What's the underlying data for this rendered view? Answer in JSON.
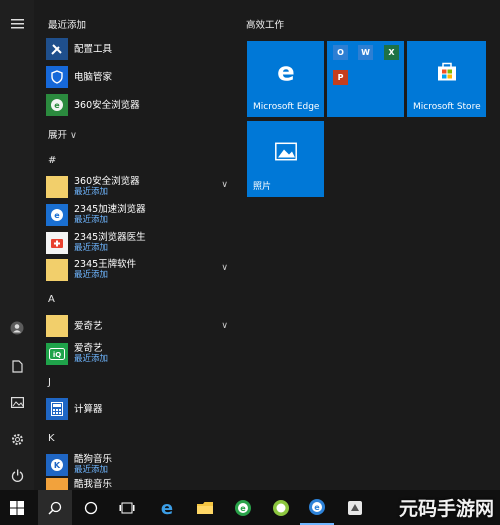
{
  "rail": {
    "menu_icon": "hamburger-icon",
    "user_icon": "user-icon",
    "docs_icon": "document-icon",
    "pictures_icon": "pictures-icon",
    "settings_icon": "gear-icon",
    "power_icon": "power-icon"
  },
  "recent": {
    "title": "最近添加",
    "items": [
      {
        "name": "配置工具",
        "icon": "tools-icon"
      },
      {
        "name": "电脑管家",
        "icon": "shield-icon"
      },
      {
        "name": "360安全浏览器",
        "icon": "browser-360-icon"
      }
    ],
    "expand": "展开"
  },
  "groups": [
    {
      "letter": "#"
    },
    {
      "letter": "A"
    },
    {
      "letter": "J"
    },
    {
      "letter": "K"
    }
  ],
  "apps": [
    {
      "name": "360安全浏览器",
      "sub": "最近添加",
      "icon": "folder-icon"
    },
    {
      "name": "2345加速浏览器",
      "sub": "最近添加",
      "icon": "browser-2345-icon"
    },
    {
      "name": "2345浏览器医生",
      "sub": "最近添加",
      "icon": "first-aid-icon"
    },
    {
      "name": "2345王牌软件",
      "sub": "最近添加",
      "icon": "folder-icon"
    },
    {
      "name": "爱奇艺",
      "sub": "",
      "icon": "folder-icon"
    },
    {
      "name": "爱奇艺",
      "sub": "最近添加",
      "icon": "iqiyi-icon"
    },
    {
      "name": "计算器",
      "sub": "",
      "icon": "calculator-icon"
    },
    {
      "name": "酷狗音乐",
      "sub": "最近添加",
      "icon": "kugou-icon"
    },
    {
      "name": "酷我音乐",
      "sub": "",
      "icon": "kuwo-icon"
    }
  ],
  "tiles": {
    "title": "高效工作",
    "edge_label": "Microsoft Edge",
    "store_label": "Microsoft Store",
    "photos_label": "照片",
    "office_minis": [
      "O",
      "W",
      "X",
      "P"
    ]
  },
  "colors": {
    "tile_blue": "#0078d7",
    "link_blue": "#6fb6ff"
  },
  "watermark": "元码手游网"
}
